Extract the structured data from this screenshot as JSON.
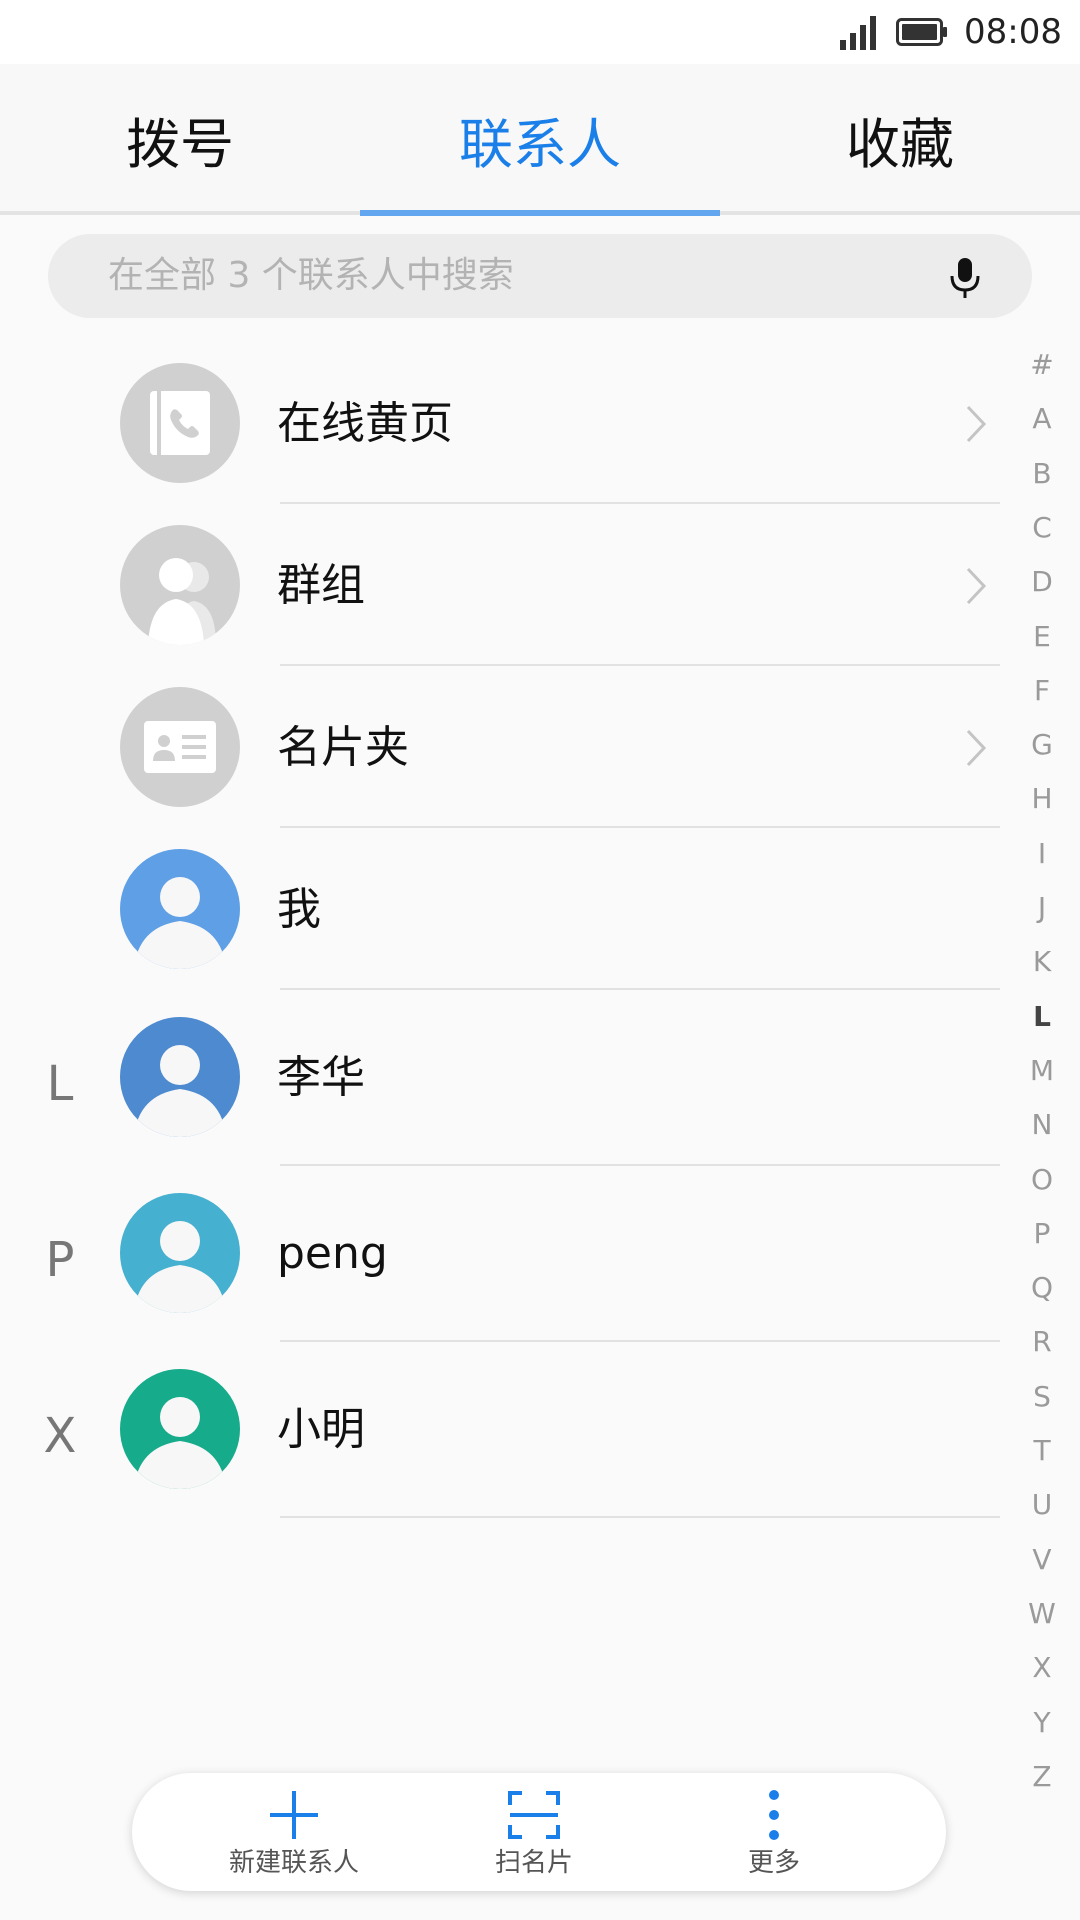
{
  "status_bar": {
    "time": "08:08",
    "signal_icon": "signal-icon",
    "battery_icon": "battery-icon"
  },
  "tabs": [
    {
      "label": "拨号",
      "active": false
    },
    {
      "label": "联系人",
      "active": true
    },
    {
      "label": "收藏",
      "active": false
    }
  ],
  "search": {
    "placeholder": "在全部 3 个联系人中搜索",
    "icon": "mic-icon"
  },
  "special_entries": [
    {
      "label": "在线黄页",
      "icon": "yellow-pages-icon",
      "has_chevron": true
    },
    {
      "label": "群组",
      "icon": "group-icon",
      "has_chevron": true
    },
    {
      "label": "名片夹",
      "icon": "business-card-icon",
      "has_chevron": true
    }
  ],
  "me": {
    "label": "我",
    "avatar_color": "#5e9fe6"
  },
  "contacts": [
    {
      "section": "L",
      "name": "李华",
      "avatar_color": "#4d8acf"
    },
    {
      "section": "P",
      "name": "peng",
      "avatar_color": "#45b0cf"
    },
    {
      "section": "X",
      "name": "小明",
      "avatar_color": "#16ab8a"
    }
  ],
  "alphabet_index": [
    "#",
    "A",
    "B",
    "C",
    "D",
    "E",
    "F",
    "G",
    "H",
    "I",
    "J",
    "K",
    "L",
    "M",
    "N",
    "O",
    "P",
    "Q",
    "R",
    "S",
    "T",
    "U",
    "V",
    "W",
    "X",
    "Y",
    "Z"
  ],
  "alphabet_active": "L",
  "bottom_actions": [
    {
      "label": "新建联系人",
      "icon": "plus-icon"
    },
    {
      "label": "扫名片",
      "icon": "scan-card-icon"
    },
    {
      "label": "更多",
      "icon": "more-vertical-icon"
    }
  ],
  "colors": {
    "accent": "#1a7fe8",
    "indicator": "#62a6ef",
    "placeholder_avatar": "#d0d0d0"
  }
}
